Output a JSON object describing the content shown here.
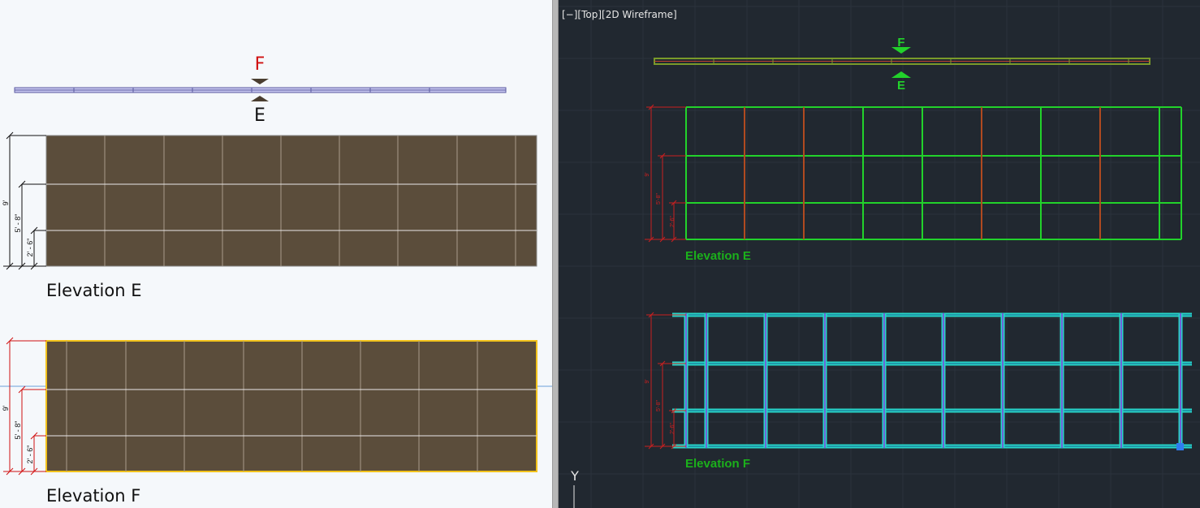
{
  "left": {
    "section_arrow_top": "F",
    "section_arrow_bottom": "E",
    "elevation_e": {
      "title": "Elevation E",
      "dims": [
        "9'",
        "5' - 8\"",
        "2' - 6\""
      ]
    },
    "elevation_f": {
      "title": "Elevation F",
      "dims": [
        "9'",
        "5' - 8\"",
        "2' - 6\""
      ]
    }
  },
  "viewport": {
    "label": "[−][Top][2D Wireframe]",
    "section_arrow_top": "F",
    "section_arrow_bottom": "E",
    "elevation_e": {
      "title": "Elevation E",
      "dims": [
        "9'",
        "5'-8\"",
        "2'-6\""
      ]
    },
    "elevation_f": {
      "title": "Elevation F",
      "dims": [
        "9'",
        "5'-8\"",
        "2'-6\""
      ]
    },
    "ucs_axis_label": "Y"
  },
  "colors": {
    "panel_fill": "#5b4d3b",
    "panel_grid": "#a89c8b",
    "selection": "#f2c21b",
    "cad_green": "#22d22b",
    "cad_red": "#cc2020",
    "cad_cyan": "#27d6c8",
    "cad_purple": "#6f62d8"
  }
}
